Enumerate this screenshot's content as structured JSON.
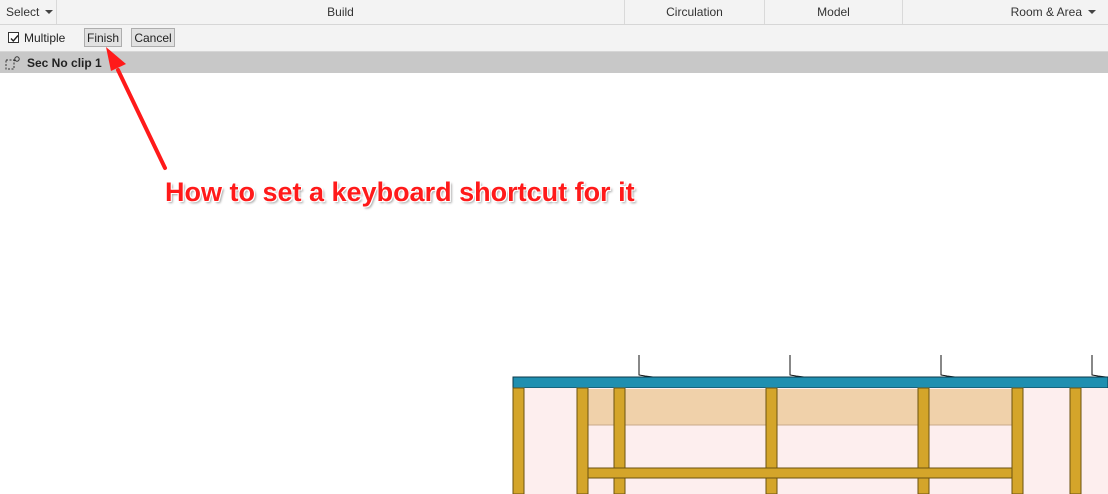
{
  "ribbon": {
    "select_label": "Select",
    "build_label": "Build",
    "circulation_label": "Circulation",
    "model_label": "Model",
    "room_area_label": "Room & Area"
  },
  "options_bar": {
    "multiple_label": "Multiple",
    "multiple_checked": true,
    "finish_label": "Finish",
    "cancel_label": "Cancel"
  },
  "view": {
    "title": "Sec No clip 1",
    "icon": "section-view-icon"
  },
  "annotation": {
    "text": "How to set a keyboard shortcut for it",
    "color": "#ff1a1a"
  },
  "drawing": {
    "roof_color": "#1f8fb0",
    "stud_color": "#d4a52a",
    "insulation_color": "#f0d1aa",
    "wall_fill_color": "#fdeeee"
  }
}
